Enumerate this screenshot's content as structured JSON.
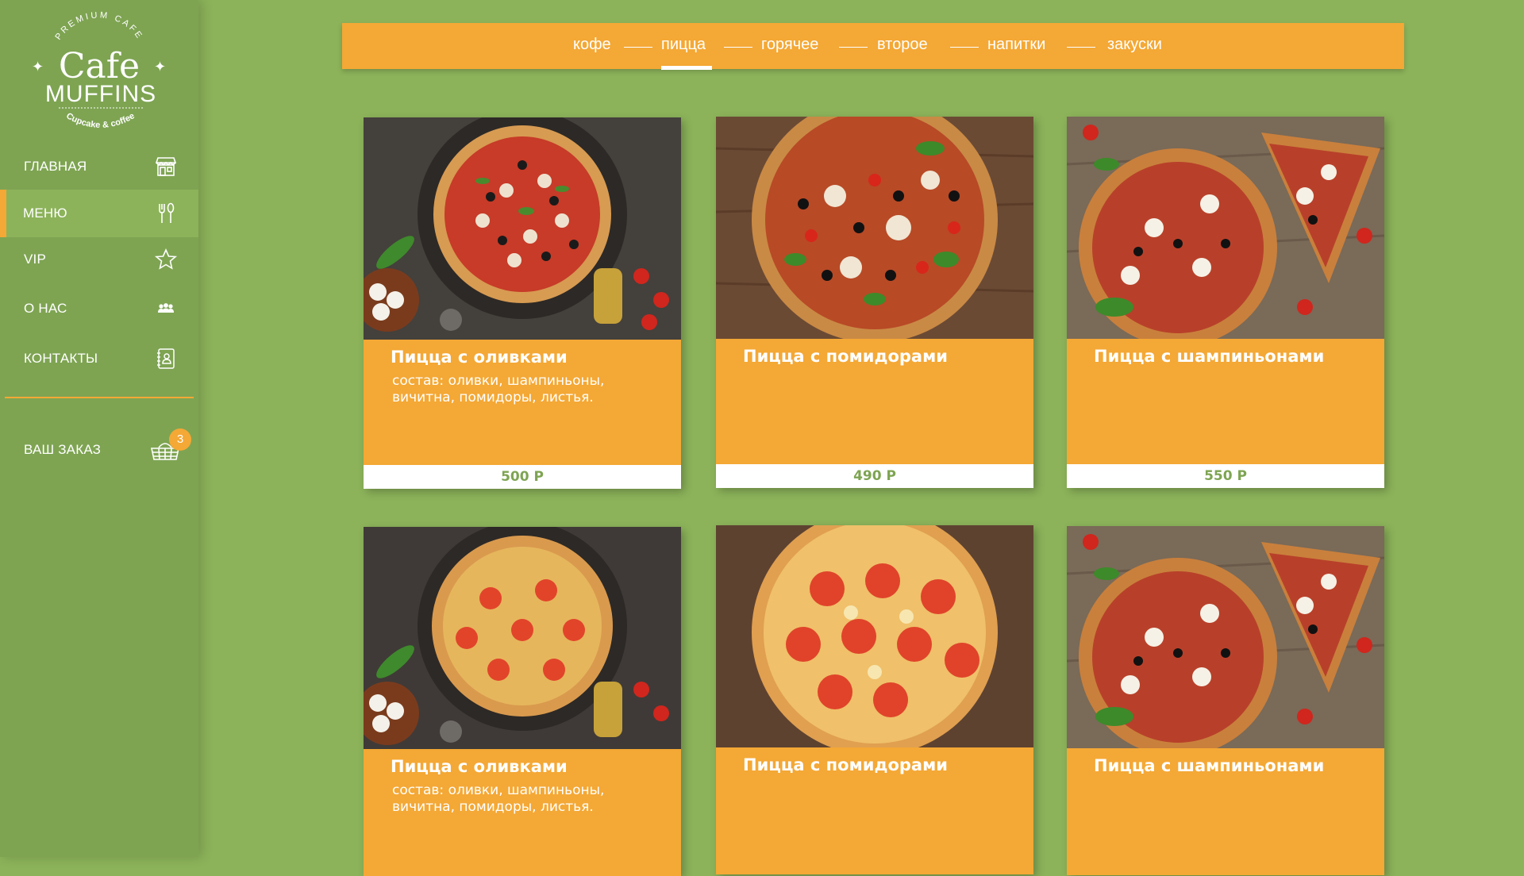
{
  "brand": {
    "top_text": "PREMIUM CAFE",
    "name_line1": "Cafe",
    "name_line2": "MUFFINS",
    "tagline": "Cupcake & coffee"
  },
  "sidebar": {
    "items": [
      {
        "label": "ГЛАВНАЯ",
        "icon": "store-icon"
      },
      {
        "label": "МЕНЮ",
        "icon": "fork-spoon-icon",
        "active": true
      },
      {
        "label": "VIP",
        "icon": "star-icon"
      },
      {
        "label": "О НАС",
        "icon": "people-icon"
      },
      {
        "label": "КОНТАКТЫ",
        "icon": "contacts-book-icon"
      }
    ],
    "order": {
      "label": "ВАШ ЗАКАЗ",
      "icon": "basket-icon",
      "count": "3"
    }
  },
  "categories": {
    "items": [
      "кофе",
      "пицца",
      "горячее",
      "второе",
      "напитки",
      "закуски"
    ],
    "active": "пицца"
  },
  "products": [
    {
      "title": "Пицца с оливками",
      "description": "состав: оливки, шампиньоны, вичитна, помидоры, листья.",
      "price": "500 Р"
    },
    {
      "title": "Пицца с помидорами",
      "description": "",
      "price": "490 Р"
    },
    {
      "title": "Пицца с шампиньонами",
      "description": "",
      "price": "550 Р"
    },
    {
      "title": "Пицца с оливками",
      "description": "состав: оливки, шампиньоны, вичитна, помидоры, листья.",
      "price": ""
    },
    {
      "title": "Пицца с помидорами",
      "description": "",
      "price": ""
    },
    {
      "title": "Пицца с шампиньонами",
      "description": "",
      "price": ""
    }
  ],
  "colors": {
    "background": "#8cb35a",
    "sidebar": "#7ea452",
    "accent": "#f4a835",
    "price_text": "#7ea452"
  }
}
